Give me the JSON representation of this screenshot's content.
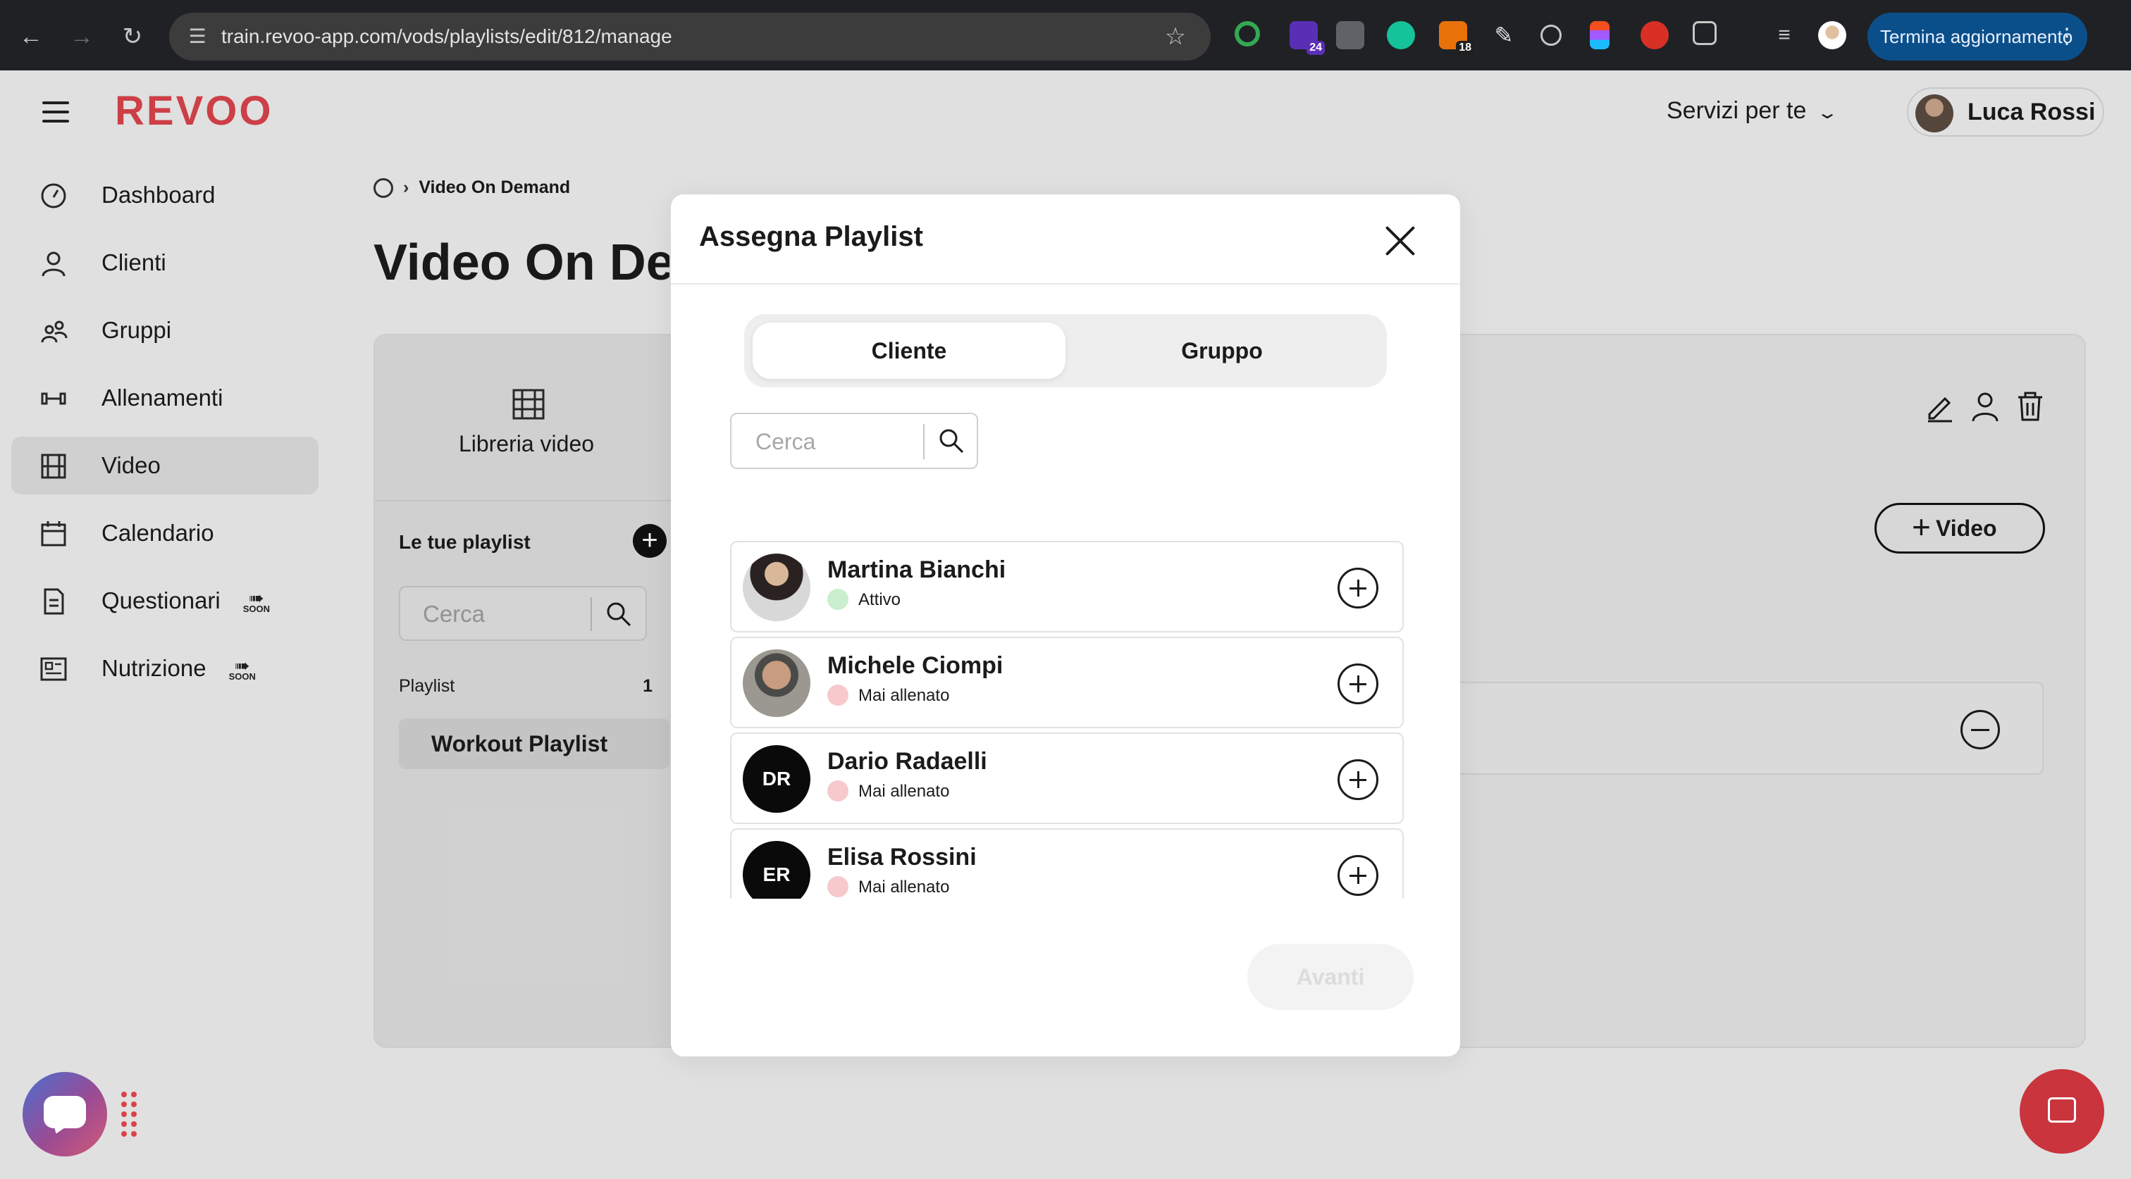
{
  "browser": {
    "url": "train.revoo-app.com/vods/playlists/edit/812/manage",
    "update_label": "Termina aggiornamento",
    "ext_badge_1": "24",
    "ext_badge_2": "18"
  },
  "app": {
    "logo": "REVOO",
    "services_label": "Servizi per te",
    "user_name": "Luca Rossi"
  },
  "sidebar": {
    "items": [
      {
        "label": "Dashboard"
      },
      {
        "label": "Clienti"
      },
      {
        "label": "Gruppi"
      },
      {
        "label": "Allenamenti"
      },
      {
        "label": "Video"
      },
      {
        "label": "Calendario"
      },
      {
        "label": "Questionari",
        "badge": "SOON"
      },
      {
        "label": "Nutrizione",
        "badge": "SOON"
      }
    ]
  },
  "page": {
    "breadcrumb": "Video On Demand",
    "title": "Video On Demand",
    "library_tab": "Libreria video",
    "playlists_heading": "Le tue playlist",
    "playlist_search_placeholder": "Cerca",
    "playlist_list_label": "Playlist",
    "playlist_count": "1",
    "playlist_item": "Workout Playlist",
    "add_video_label": "Video"
  },
  "modal": {
    "title": "Assegna Playlist",
    "tabs": [
      "Cliente",
      "Gruppo"
    ],
    "active_tab": "Cliente",
    "search_placeholder": "Cerca",
    "clients": [
      {
        "name": "Martina Bianchi",
        "status": "Attivo",
        "initials": "",
        "status_color": "#c9efce"
      },
      {
        "name": "Michele Ciompi",
        "status": "Mai allenato",
        "initials": "",
        "status_color": "#f7c8cc"
      },
      {
        "name": "Dario Radaelli",
        "status": "Mai allenato",
        "initials": "DR",
        "status_color": "#f7c8cc"
      },
      {
        "name": "Elisa Rossini",
        "status": "Mai allenato",
        "initials": "ER",
        "status_color": "#f7c8cc"
      }
    ],
    "next_label": "Avanti"
  },
  "colors": {
    "brand": "#d9434a",
    "status_active": "#c9efce",
    "status_never": "#f7c8cc"
  }
}
